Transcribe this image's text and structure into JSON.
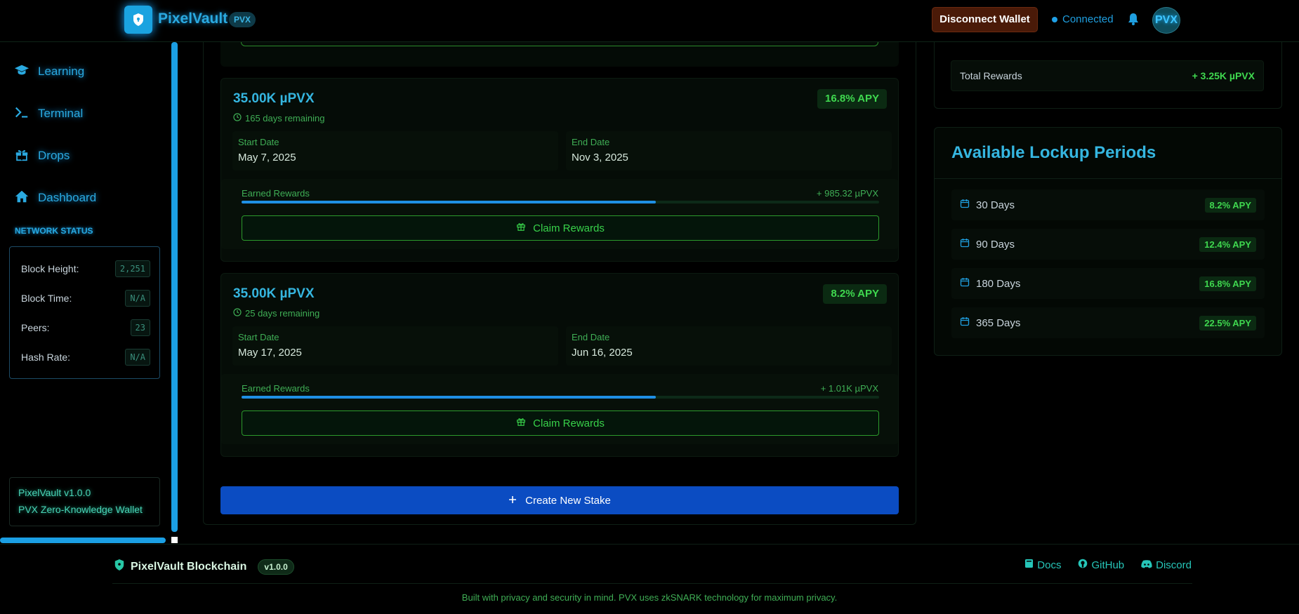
{
  "header": {
    "app_name": "PixelVault",
    "app_badge": "PVX",
    "disconnect_label": "Disconnect  Wallet",
    "status": "Connected",
    "avatar_label": "PVX"
  },
  "sidebar": {
    "nav": [
      {
        "label": "Learning",
        "icon": "graduation-cap-icon"
      },
      {
        "label": "Terminal",
        "icon": "terminal-icon"
      },
      {
        "label": "Drops",
        "icon": "gift-icon"
      },
      {
        "label": "Dashboard",
        "icon": "home-icon"
      }
    ],
    "network_title": "NETWORK STATUS",
    "network": [
      {
        "label": "Block Height:",
        "value": "2,251"
      },
      {
        "label": "Block Time:",
        "value": "N/A"
      },
      {
        "label": "Peers:",
        "value": "23"
      },
      {
        "label": "Hash Rate:",
        "value": "N/A"
      }
    ],
    "version": "PixelVault v1.0.0",
    "tagline": "PVX Zero-Knowledge Wallet"
  },
  "stakes": [
    {
      "amount": "35.00K µPVX",
      "remaining": "165 days remaining",
      "apy": "16.8% APY",
      "start_label": "Start Date",
      "start_date": "May 7, 2025",
      "end_label": "End Date",
      "end_date": "Nov 3, 2025",
      "rewards_label": "Earned Rewards",
      "rewards_value": "+ 985.32 µPVX",
      "progress": 0.65,
      "claim_label": "Claim Rewards"
    },
    {
      "amount": "35.00K µPVX",
      "remaining": "25 days remaining",
      "apy": "8.2% APY",
      "start_label": "Start Date",
      "start_date": "May 17, 2025",
      "end_label": "End Date",
      "end_date": "Jun 16, 2025",
      "rewards_label": "Earned Rewards",
      "rewards_value": "+ 1.01K µPVX",
      "progress": 0.65,
      "claim_label": "Claim Rewards"
    }
  ],
  "create_stake_label": "Create New Stake",
  "summary": {
    "total_label": "Total Rewards",
    "total_value": "+ 3.25K µPVX"
  },
  "lockup": {
    "title": "Available Lockup Periods",
    "periods": [
      {
        "label": "30 Days",
        "apy": "8.2% APY"
      },
      {
        "label": "90 Days",
        "apy": "12.4% APY"
      },
      {
        "label": "180 Days",
        "apy": "16.8% APY"
      },
      {
        "label": "365 Days",
        "apy": "22.5% APY"
      }
    ]
  },
  "footer": {
    "brand": "PixelVault Blockchain",
    "version": "v1.0.0",
    "links": [
      "Docs",
      "GitHub",
      "Discord"
    ],
    "note": "Built with privacy and security in mind. PVX uses zkSNARK technology for maximum privacy."
  },
  "colors": {
    "accent_blue": "#2aa9e0",
    "accent_green": "#3fd84f",
    "button_blue": "#0b4cc2",
    "danger_bg": "#4a1a08"
  }
}
